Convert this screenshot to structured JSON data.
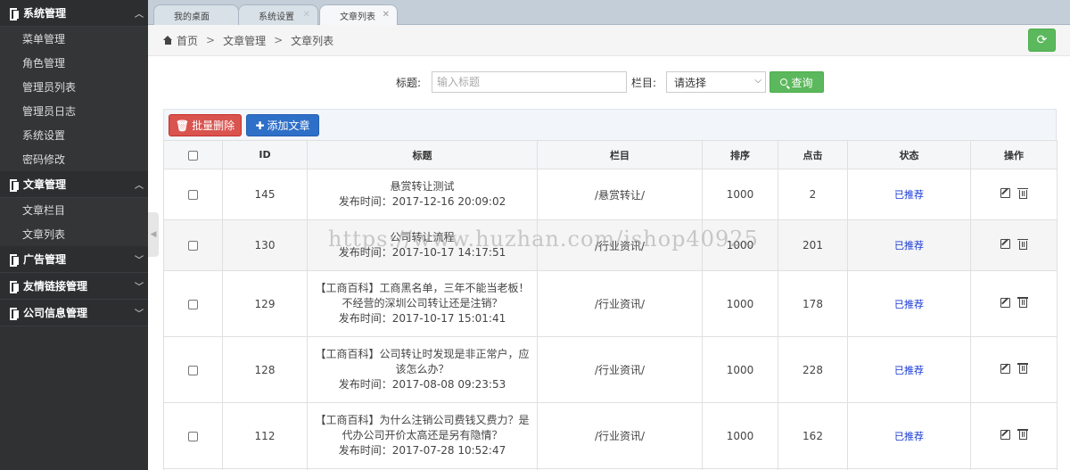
{
  "sidebar": {
    "groups": [
      {
        "label": "系统管理",
        "expanded": true,
        "items": [
          "菜单管理",
          "角色管理",
          "管理员列表",
          "管理员日志",
          "系统设置",
          "密码修改"
        ]
      },
      {
        "label": "文章管理",
        "expanded": true,
        "items": [
          "文章栏目",
          "文章列表"
        ]
      },
      {
        "label": "广告管理",
        "expanded": false,
        "items": []
      },
      {
        "label": "友情链接管理",
        "expanded": false,
        "items": []
      },
      {
        "label": "公司信息管理",
        "expanded": false,
        "items": []
      }
    ]
  },
  "tabs": [
    {
      "label": "我的桌面",
      "active": false
    },
    {
      "label": "系统设置",
      "active": false
    },
    {
      "label": "文章列表",
      "active": true
    }
  ],
  "breadcrumb": [
    "首页",
    "文章管理",
    "文章列表"
  ],
  "search": {
    "title_label": "标题:",
    "title_placeholder": "输入标题",
    "category_label": "栏目:",
    "category_value": "请选择",
    "query_label": "查询"
  },
  "toolbar": {
    "batch_delete": "批量删除",
    "add_article": "添加文章"
  },
  "table": {
    "headers": [
      "",
      "ID",
      "标题",
      "栏目",
      "排序",
      "点击",
      "状态",
      "操作"
    ],
    "rows": [
      {
        "id": "145",
        "title": "悬赏转让测试",
        "publish": "发布时间：2017-12-16 20:09:02",
        "category": "/悬赏转让/",
        "sort": "1000",
        "clicks": "2",
        "status": "已推荐"
      },
      {
        "id": "130",
        "title": "公司转让流程",
        "publish": "发布时间：2017-10-17 14:17:51",
        "category": "/行业资讯/",
        "sort": "1000",
        "clicks": "201",
        "status": "已推荐"
      },
      {
        "id": "129",
        "title": "【工商百科】工商黑名单，三年不能当老板！不经营的深圳公司转让还是注销？",
        "publish": "发布时间：2017-10-17 15:01:41",
        "category": "/行业资讯/",
        "sort": "1000",
        "clicks": "178",
        "status": "已推荐"
      },
      {
        "id": "128",
        "title": "【工商百科】公司转让时发现是非正常户，应该怎么办？",
        "publish": "发布时间：2017-08-08 09:23:53",
        "category": "/行业资讯/",
        "sort": "1000",
        "clicks": "228",
        "status": "已推荐"
      },
      {
        "id": "112",
        "title": "【工商百科】为什么注销公司费钱又费力？是代办公司开价太高还是另有隐情？",
        "publish": "发布时间：2017-07-28 10:52:47",
        "category": "/行业资讯/",
        "sort": "1000",
        "clicks": "162",
        "status": "已推荐"
      }
    ]
  },
  "watermark": "https://www.huzhan.com/ishop40925"
}
